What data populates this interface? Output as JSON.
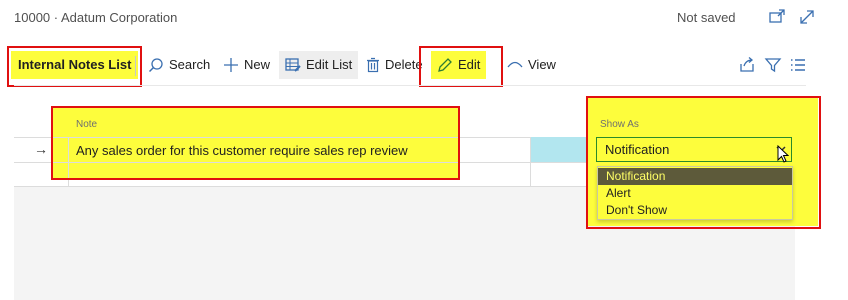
{
  "header": {
    "title": "10000 · Adatum Corporation",
    "status": "Not saved",
    "icons": {
      "open_new": "open-new-window-icon",
      "expand": "expand-icon"
    }
  },
  "actionbar": {
    "page_tab": "Internal Notes List",
    "search": "Search",
    "new": "New",
    "edit_list": "Edit List",
    "delete": "Delete",
    "edit": "Edit",
    "view": "View",
    "icons": [
      "share-icon",
      "filter-icon",
      "list-view-icon"
    ]
  },
  "grid": {
    "columns": {
      "note": "Note",
      "show_as": "Show As"
    },
    "rows": [
      {
        "note": "Any sales order for this customer require sales rep review",
        "show_as": "Notification"
      }
    ]
  },
  "dropdown": {
    "options": [
      "Notification",
      "Alert",
      "Don't Show"
    ],
    "selected": "Notification"
  },
  "colors": {
    "highlight": "#fdfd3c",
    "annotation_border": "#e01010",
    "focus_border": "#2a8a2a",
    "selected_option_bg": "#5d5a3a",
    "cyan_cell": "#b2e6ef"
  }
}
